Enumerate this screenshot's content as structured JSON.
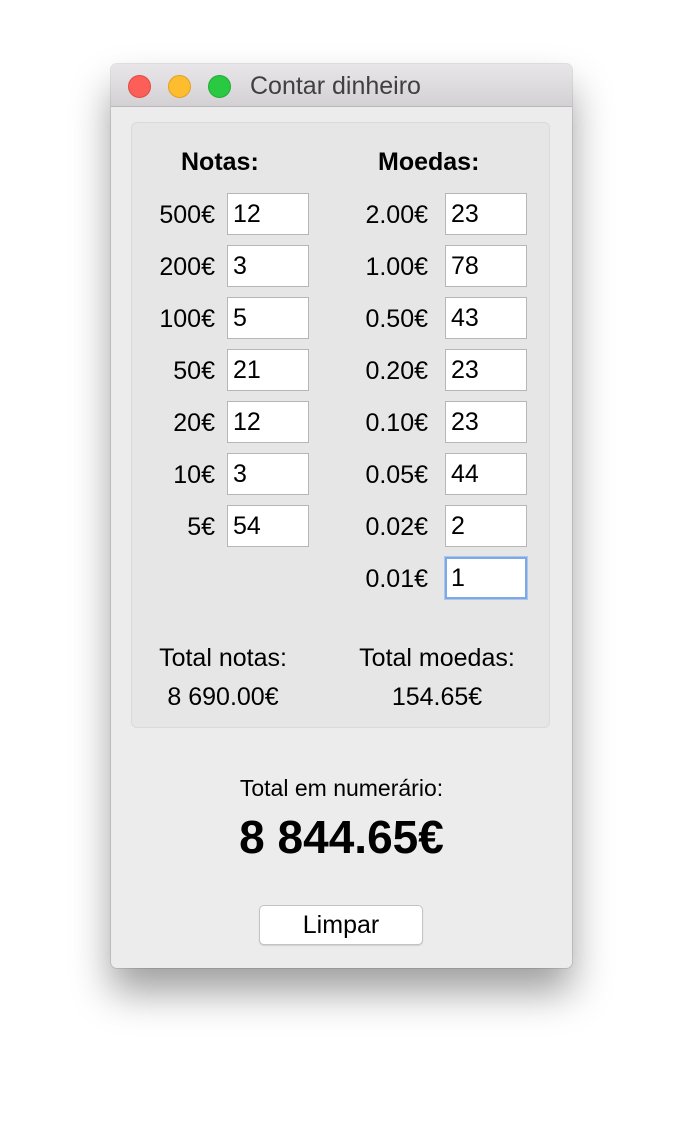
{
  "window": {
    "title": "Contar dinheiro"
  },
  "notes": {
    "header": "Notas:",
    "rows": [
      {
        "label": "500€",
        "value": "12"
      },
      {
        "label": "200€",
        "value": "3"
      },
      {
        "label": "100€",
        "value": "5"
      },
      {
        "label": "50€",
        "value": "21"
      },
      {
        "label": "20€",
        "value": "12"
      },
      {
        "label": "10€",
        "value": "3"
      },
      {
        "label": "5€",
        "value": "54"
      }
    ],
    "total_label": "Total notas:",
    "total_value": "8 690.00€"
  },
  "coins": {
    "header": "Moedas:",
    "rows": [
      {
        "label": "2.00€",
        "value": "23"
      },
      {
        "label": "1.00€",
        "value": "78"
      },
      {
        "label": "0.50€",
        "value": "43"
      },
      {
        "label": "0.20€",
        "value": "23"
      },
      {
        "label": "0.10€",
        "value": "23"
      },
      {
        "label": "0.05€",
        "value": "44"
      },
      {
        "label": "0.02€",
        "value": "2"
      },
      {
        "label": "0.01€",
        "value": "1"
      }
    ],
    "total_label": "Total moedas:",
    "total_value": "154.65€"
  },
  "grand_total": {
    "label": "Total em numerário:",
    "value": "8 844.65€"
  },
  "buttons": {
    "clear": "Limpar"
  },
  "colors": {
    "close": "#fc5f57",
    "minimize": "#fdbd2e",
    "zoom": "#29c941",
    "focus_ring": "#7fa8e6"
  }
}
